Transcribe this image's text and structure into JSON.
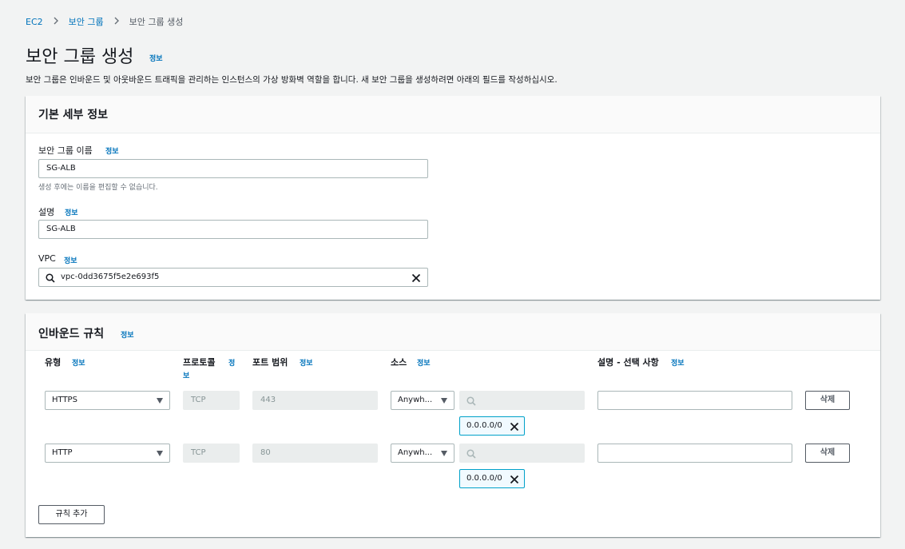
{
  "breadcrumb": {
    "items": [
      "EC2",
      "보안 그룹",
      "보안 그룹 생성"
    ]
  },
  "page": {
    "title": "보안 그룹 생성",
    "info": "정보",
    "description": "보안 그룹은 인바운드 및 아웃바운드 트래픽을 관리하는 인스턴스의 가상 방화벽 역할을 합니다. 새 보안 그룹을 생성하려면 아래의 필드를 작성하십시오."
  },
  "basic": {
    "title": "기본 세부 정보",
    "name_label": "보안 그룹 이름",
    "name_info": "정보",
    "name_value": "SG-ALB",
    "name_hint": "생성 후에는 이름을 편집할 수 없습니다.",
    "desc_label": "설명",
    "desc_info": "정보",
    "desc_value": "SG-ALB",
    "vpc_label": "VPC",
    "vpc_info": "정보",
    "vpc_value": "vpc-0dd3675f5e2e693f5"
  },
  "inbound": {
    "title": "인바운드 규칙",
    "info": "정보",
    "columns": {
      "type": "유형",
      "type_info": "정보",
      "protocol": "프로토콜",
      "protocol_info_1": "정",
      "protocol_info_2": "보",
      "port": "포트 범위",
      "port_info": "정보",
      "source": "소스",
      "source_info": "정보",
      "desc": "설명 - 선택 사항",
      "desc_info": "정보"
    },
    "rules": [
      {
        "type": "HTTPS",
        "protocol": "TCP",
        "port": "443",
        "source": "Anywh...",
        "cidr": "0.0.0.0/0",
        "delete": "삭제"
      },
      {
        "type": "HTTP",
        "protocol": "TCP",
        "port": "80",
        "source": "Anywh...",
        "cidr": "0.0.0.0/0",
        "delete": "삭제"
      }
    ],
    "add_rule": "규칙 추가"
  }
}
